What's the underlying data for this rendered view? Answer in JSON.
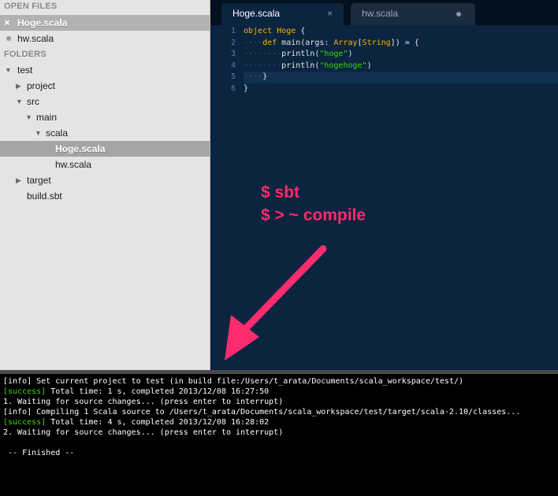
{
  "sidebar": {
    "open_files_header": "OPEN FILES",
    "open_files": [
      {
        "label": "Hoge.scala",
        "selected": true
      },
      {
        "label": "hw.scala",
        "selected": false
      }
    ],
    "folders_header": "FOLDERS",
    "tree": [
      {
        "label": "test",
        "expanded": true
      },
      {
        "label": "project",
        "expanded": false
      },
      {
        "label": "src",
        "expanded": true
      },
      {
        "label": "main",
        "expanded": true
      },
      {
        "label": "scala",
        "expanded": true
      },
      {
        "label": "Hoge.scala",
        "selected": true
      },
      {
        "label": "hw.scala"
      },
      {
        "label": "target",
        "expanded": false
      },
      {
        "label": "build.sbt"
      }
    ]
  },
  "tabs": [
    {
      "label": "Hoge.scala",
      "active": true,
      "close_icon": "×"
    },
    {
      "label": "hw.scala",
      "active": false,
      "modified": true
    }
  ],
  "editor": {
    "line_numbers": [
      "1",
      "2",
      "3",
      "4",
      "5",
      "6"
    ],
    "lines": [
      "object Hoge {",
      "    def main(args: Array[String]) = {",
      "        println(\"hoge\")",
      "        println(\"hogehoge\")",
      "    }",
      "}"
    ],
    "current_line": 5
  },
  "annotation": {
    "line1": "$ sbt",
    "line2": "$ > ~ compile",
    "color": "#ff2d6e"
  },
  "console": {
    "lines": [
      {
        "prefix": "[info]",
        "text": " Set current project to test (in build file:/Users/t_arata/Documents/scala_workspace/test/)"
      },
      {
        "prefix": "[success]",
        "text": " Total time: 1 s, completed 2013/12/08 16:27:50"
      },
      {
        "prefix": "",
        "text": "1. Waiting for source changes... (press enter to interrupt)"
      },
      {
        "prefix": "[info]",
        "text": " Compiling 1 Scala source to /Users/t_arata/Documents/scala_workspace/test/target/scala-2.10/classes..."
      },
      {
        "prefix": "[success]",
        "text": " Total time: 4 s, completed 2013/12/08 16:28:02"
      },
      {
        "prefix": "",
        "text": "2. Waiting for source changes... (press enter to interrupt)"
      },
      {
        "prefix": "",
        "text": ""
      },
      {
        "prefix": "",
        "text": " -- Finished --"
      }
    ]
  },
  "colors": {
    "keyword": "#ffb000",
    "string": "#3ad900",
    "editor_bg": "#0b2440",
    "success": "#3ad900"
  }
}
